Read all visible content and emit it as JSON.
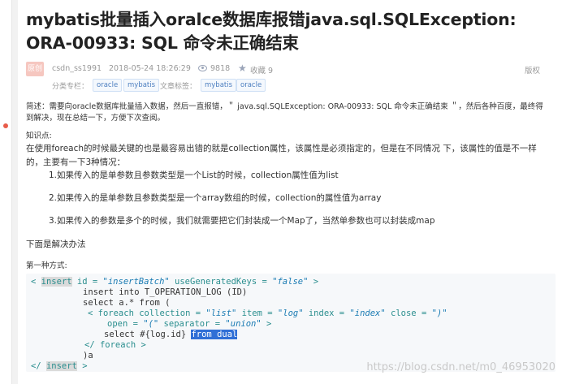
{
  "article": {
    "title": "mybatis批量插入oralce数据库报错java.sql.SQLException: ORA-00933: SQL 命令未正确结束",
    "badge": "原创",
    "author": "csdn_ss1991",
    "date": "2018-05-24 18:26:29",
    "views": "9818",
    "favorites": "收藏 9",
    "copyright": "版权",
    "column_label": "分类专栏：",
    "column_tags": [
      "oracle",
      "mybatis"
    ],
    "article_tags_label": "文章标签：",
    "article_tags": [
      "mybatis",
      "oracle"
    ]
  },
  "content": {
    "summary": "简述：需要向oracle数据库批量插入数据，然后一直报错，＂ java.sql.SQLException: ORA-00933: SQL 命令未正确结束 ＂，然后各种百度，最终得到解决，现在总结一下，方便下次查阅。",
    "knowledge_label": "知识点:",
    "para1": "在使用foreach的时候最关键的也是最容易出错的就是collection属性，该属性是必须指定的，但是在不同情况 下，该属性的值是不一样",
    "para2": "的，主要有一下3种情况：",
    "item1": "1.如果传入的是单参数且参数类型是一个List的时候，collection属性值为list",
    "item2": "2.如果传入的是单参数且参数类型是一个array数组的时候，collection的属性值为array",
    "item3": "3.如果传入的参数是多个的时候，我们就需要把它们封装成一个Map了，当然单参数也可以封装成map",
    "solution": "下面是解决办法",
    "method1": "第一种方式:"
  },
  "code": {
    "l1_open": "< ",
    "l1_tag": "insert",
    "l1_attr1": " id = ",
    "l1_val1": "\"insertBatch\"",
    "l1_attr2": " useGeneratedKeys = ",
    "l1_val2": "\"false\"",
    "l1_close": " >",
    "l2": "insert into T_OPERATION_LOG (ID)",
    "l3": "select a.* from (",
    "l4_open": "< foreach collection = ",
    "l4_v1": "\"list\"",
    "l4_a2": " item = ",
    "l4_v2": "\"log\"",
    "l4_a3": " index = ",
    "l4_v3": "\"index\"",
    "l4_a4": " close = ",
    "l4_v4": "\")\"",
    "l5_a": "open = ",
    "l5_v1": "\"(\"",
    "l5_b": " separator = ",
    "l5_v2": "\"union\"",
    "l5_c": " >",
    "l6_text": "select #{log.id} ",
    "l6_hl": "from dual",
    "l7": "</ foreach >",
    "l8": ")a",
    "l9_open": "</ ",
    "l9_tag": "insert",
    "l9_close": " >"
  },
  "watermark": "https://blog.csdn.net/m0_46953020",
  "colors": {
    "accent": "#e85c4a",
    "tag_text": "#4d7fc0",
    "code_keyword": "#2a8e8e",
    "code_string": "#1a7bb3",
    "highlight": "#2f6fd6"
  }
}
